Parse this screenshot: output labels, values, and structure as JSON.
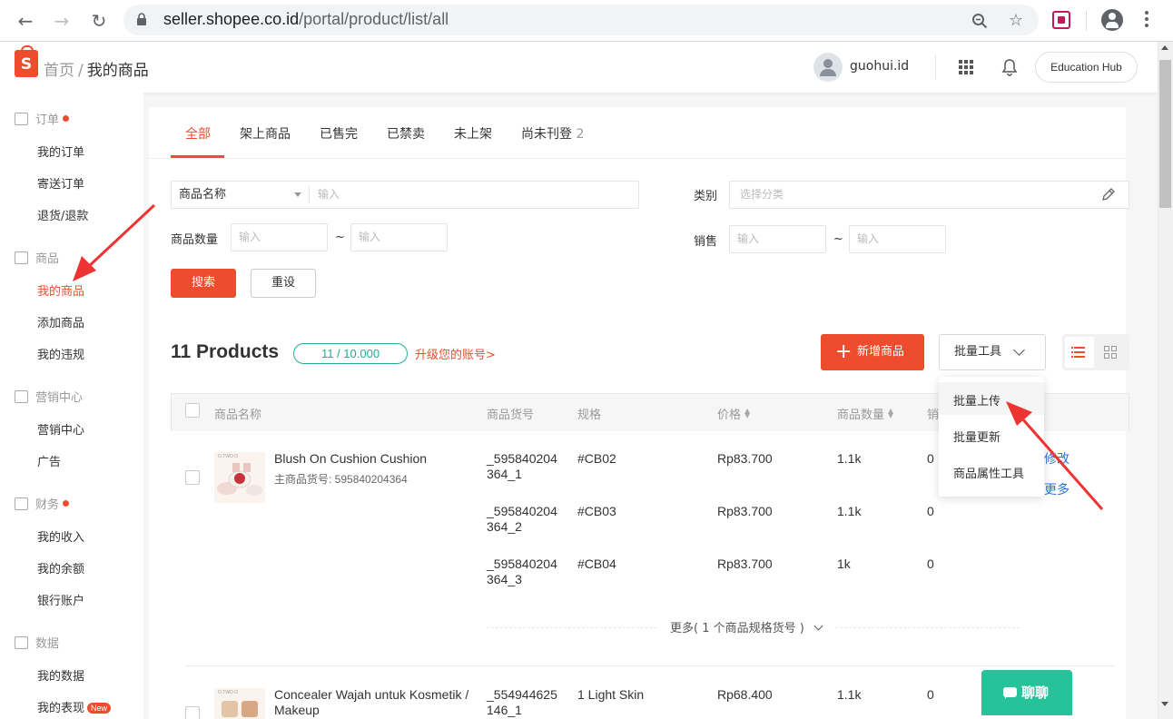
{
  "browser": {
    "url_host": "seller.shopee.co.id",
    "url_path": "/portal/product/list/all"
  },
  "header": {
    "logo_letter": "S",
    "breadcrumb_home": "首页",
    "breadcrumb_sep": "/",
    "breadcrumb_current": "我的商品",
    "username": "guohui.id",
    "education_hub": "Education Hub"
  },
  "sidebar": {
    "groups": [
      {
        "label": "订单",
        "dot": true,
        "items": [
          "我的订单",
          "寄送订单",
          "退货/退款"
        ]
      },
      {
        "label": "商品",
        "dot": false,
        "items": [
          "我的商品",
          "添加商品",
          "我的违规"
        ]
      },
      {
        "label": "营销中心",
        "dot": false,
        "items": [
          "营销中心",
          "广告"
        ]
      },
      {
        "label": "财务",
        "dot": true,
        "items": [
          "我的收入",
          "我的余额",
          "银行账户"
        ]
      },
      {
        "label": "数据",
        "dot": false,
        "items": [
          "我的数据",
          "我的表现"
        ]
      }
    ],
    "new_badge": "New"
  },
  "tabs": [
    {
      "label": "全部",
      "count": ""
    },
    {
      "label": "架上商品",
      "count": ""
    },
    {
      "label": "已售完",
      "count": ""
    },
    {
      "label": "已禁卖",
      "count": ""
    },
    {
      "label": "未上架",
      "count": ""
    },
    {
      "label": "尚未刊登",
      "count": "2"
    }
  ],
  "filters": {
    "name_select": "商品名称",
    "name_placeholder": "输入",
    "category_label": "类别",
    "category_placeholder": "选择分类",
    "qty_label": "商品数量",
    "qty_min_placeholder": "输入",
    "qty_max_placeholder": "输入",
    "tilde": "~",
    "sales_label": "销售",
    "sales_min_placeholder": "输入",
    "sales_max_placeholder": "输入",
    "search_button": "搜索",
    "reset_button": "重设"
  },
  "products_bar": {
    "count_text": "11 Products",
    "quota": "11 / 10.000",
    "upgrade_link": "升级您的账号>",
    "add_button": "新增商品",
    "bulk_button": "批量工具"
  },
  "table": {
    "headers": [
      "商品名称",
      "商品货号",
      "规格",
      "价格",
      "商品数量",
      "销"
    ],
    "products": [
      {
        "name": "Blush On Cushion Cushion",
        "main_sku": "主商品货号: 595840204364",
        "thumb_brand": "O.TWO.O",
        "variants": [
          {
            "sku_line1": "_595840204",
            "sku_line2": "364_1",
            "spec": "#CB02",
            "price": "Rp83.700",
            "qty": "1.1k",
            "sales": "0"
          },
          {
            "sku_line1": "_595840204",
            "sku_line2": "364_2",
            "spec": "#CB03",
            "price": "Rp83.700",
            "qty": "1.1k",
            "sales": "0"
          },
          {
            "sku_line1": "_595840204",
            "sku_line2": "364_3",
            "spec": "#CB04",
            "price": "Rp83.700",
            "qty": "1k",
            "sales": "0"
          }
        ],
        "action_edit": "修改",
        "action_more": "更多",
        "more_variants": "更多( 1 个商品规格货号 )"
      },
      {
        "name_line1": "Concealer Wajah untuk Kosmetik /",
        "name_line2": "Makeup",
        "thumb_brand": "O.TWO.O",
        "sku_line1": "_554944625",
        "sku_line2": "146_1",
        "spec": "1 Light Skin",
        "price": "Rp68.400",
        "qty": "1.1k",
        "sales": "0"
      }
    ]
  },
  "bulk_dropdown": {
    "items": [
      "批量上传",
      "批量更新",
      "商品属性工具"
    ]
  },
  "chat": {
    "label": "聊聊"
  },
  "colors": {
    "brand": "#ee4d2d",
    "teal": "#26aa99",
    "chat": "#26c29a",
    "link": "#2673dd"
  }
}
